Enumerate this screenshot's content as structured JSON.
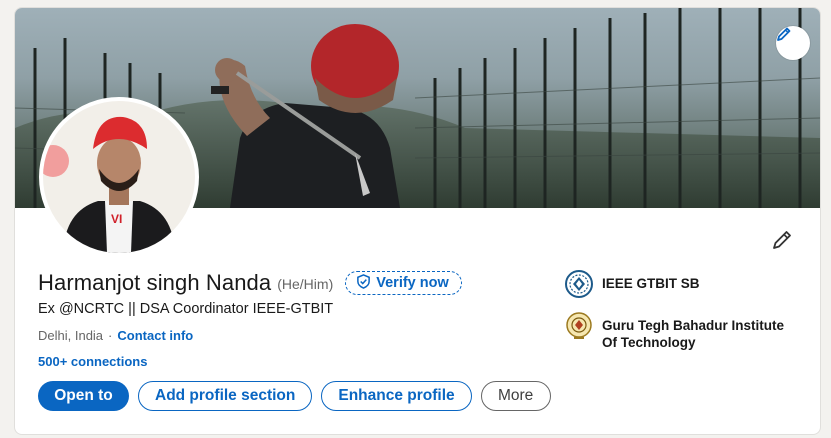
{
  "profile": {
    "name": "Harmanjot singh Nanda",
    "pronouns": "(He/Him)",
    "verify_label": "Verify now",
    "headline": "Ex @NCRTC || DSA Coordinator IEEE-GTBIT",
    "location": "Delhi, India",
    "separator": "·",
    "contact_info": "Contact info",
    "connections": "500+ connections"
  },
  "actions": {
    "open_to": "Open to",
    "add_section": "Add profile section",
    "enhance": "Enhance profile",
    "more": "More"
  },
  "organizations": [
    {
      "name": "IEEE GTBIT SB",
      "icon": "ieee-logo"
    },
    {
      "name": "Guru Tegh Bahadur Institute Of Technology",
      "icon": "gtbit-logo"
    }
  ],
  "icons": {
    "cover_edit": "pencil-icon",
    "profile_edit": "pencil-icon",
    "verify": "shield-check-icon"
  },
  "colors": {
    "accent": "#0a66c2",
    "text": "#191919",
    "muted": "#666666",
    "background": "#f3f2ef"
  }
}
